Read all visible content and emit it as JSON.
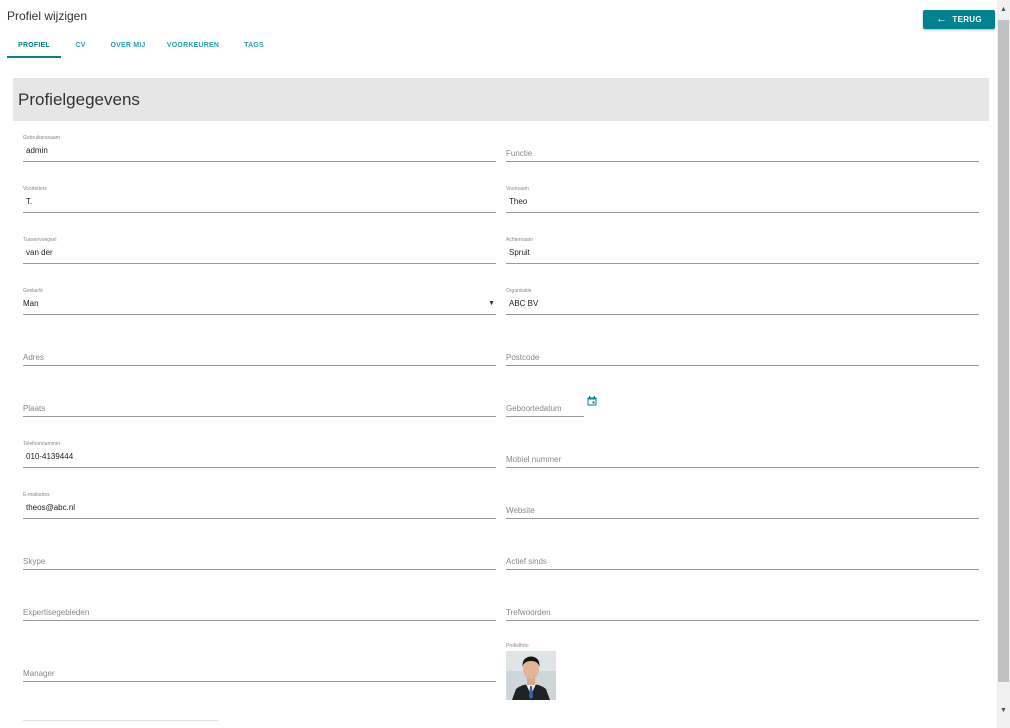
{
  "header": {
    "title": "Profiel wijzigen",
    "back_label": "TERUG",
    "back_icon": "arrow-left-icon"
  },
  "tabs": [
    {
      "label": "PROFIEL",
      "active": true
    },
    {
      "label": "CV",
      "active": false
    },
    {
      "label": "OVER MIJ",
      "active": false
    },
    {
      "label": "VOORKEUREN",
      "active": false
    },
    {
      "label": "TAGS",
      "active": false
    }
  ],
  "section": {
    "title": "Profielgegevens"
  },
  "fields": {
    "gebruikersnaam": {
      "label": "Gebruikersnaam",
      "value": "admin"
    },
    "functie": {
      "label": "Functie",
      "value": ""
    },
    "voorletters": {
      "label": "Voorletters",
      "value": "T."
    },
    "voornaam": {
      "label": "Voornaam",
      "value": "Theo"
    },
    "tussenvoegsel": {
      "label": "Tussenvoegsel",
      "value": "van der"
    },
    "achternaam": {
      "label": "Achternaam",
      "value": "Spruit"
    },
    "geslacht": {
      "label": "Geslacht",
      "value": "Man"
    },
    "organisatie": {
      "label": "Organisatie",
      "value": "ABC BV"
    },
    "adres": {
      "label": "Adres",
      "value": ""
    },
    "postcode": {
      "label": "Postcode",
      "value": ""
    },
    "plaats": {
      "label": "Plaats",
      "value": ""
    },
    "geboortedatum": {
      "label": "Geboortedatum",
      "value": ""
    },
    "telefoonnummer": {
      "label": "Telefoonnummer",
      "value": "010-4139444"
    },
    "mobiel": {
      "label": "Mobiel nummer",
      "value": ""
    },
    "email": {
      "label": "E-mailadres",
      "value": "theos@abc.nl"
    },
    "website": {
      "label": "Website",
      "value": ""
    },
    "skype": {
      "label": "Skype",
      "value": ""
    },
    "actief_sinds": {
      "label": "Actief sinds",
      "value": ""
    },
    "expertise": {
      "label": "Expertisegebieden",
      "value": ""
    },
    "trefwoorden": {
      "label": "Trefwoorden",
      "value": ""
    },
    "manager": {
      "label": "Manager",
      "value": ""
    }
  },
  "photo": {
    "label": "Profielfoto"
  },
  "colors": {
    "accent": "#00838f"
  }
}
